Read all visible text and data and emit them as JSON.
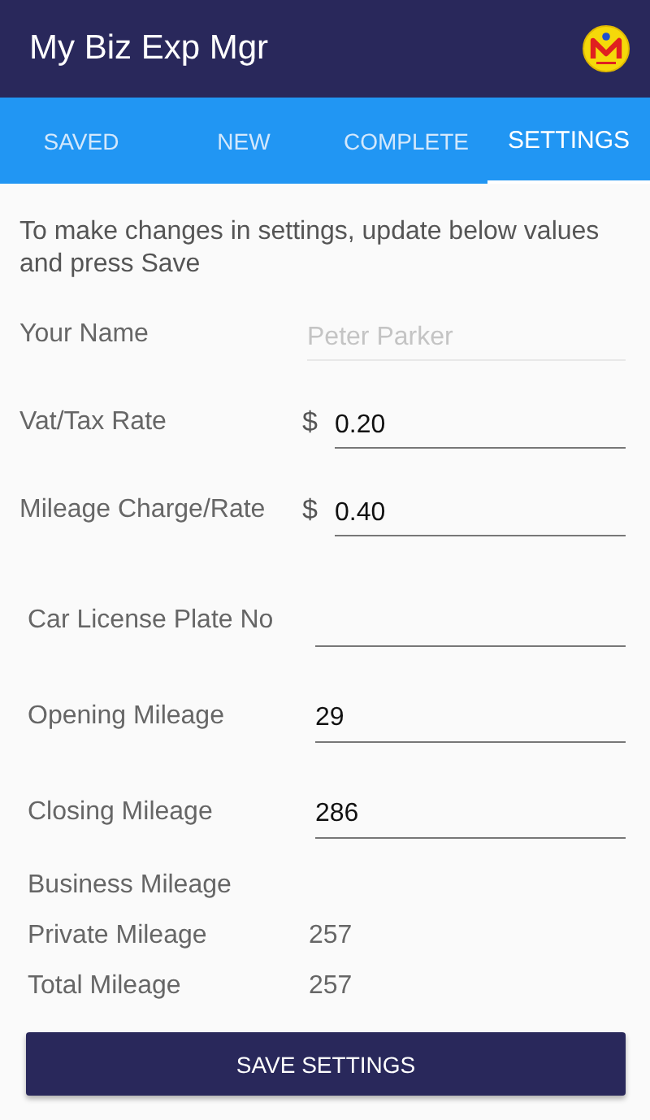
{
  "app_bar": {
    "title": "My Biz Exp Mgr"
  },
  "tabs": [
    {
      "label": "SAVED",
      "selected": false
    },
    {
      "label": "NEW",
      "selected": false
    },
    {
      "label": "COMPLETE",
      "selected": false
    },
    {
      "label": "SETTINGS",
      "selected": true
    }
  ],
  "intro": "To make changes in settings, update below values and press Save",
  "sections": [
    {
      "rows": [
        {
          "kind": "input",
          "label": "Your Name",
          "placeholder": "Peter Parker"
        },
        {
          "kind": "input",
          "label": "Vat/Tax Rate",
          "prefix": "$",
          "value": "0.20"
        },
        {
          "kind": "input",
          "label": "Mileage Charge/Rate",
          "prefix": "$",
          "value": "0.40"
        }
      ]
    },
    {
      "rows": [
        {
          "kind": "input",
          "label": "Car License Plate No"
        },
        {
          "kind": "input",
          "label": "Opening Mileage",
          "value": "29"
        },
        {
          "kind": "input",
          "label": "Closing Mileage",
          "value": "286"
        },
        {
          "kind": "readout",
          "label": "Business Mileage"
        },
        {
          "kind": "readout",
          "label": "Private Mileage",
          "value": "257"
        },
        {
          "kind": "readout",
          "label": "Total Mileage",
          "value": "257"
        }
      ]
    }
  ],
  "save_button": "SAVE SETTINGS"
}
